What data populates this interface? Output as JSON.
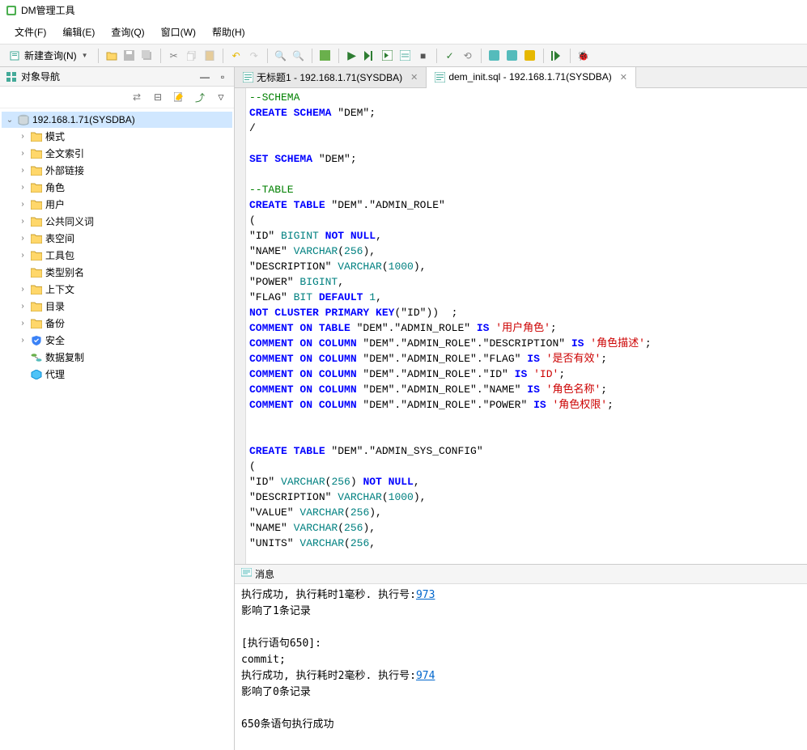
{
  "window": {
    "title": "DM管理工具"
  },
  "menu": {
    "file": "文件(F)",
    "edit": "编辑(E)",
    "query": "查询(Q)",
    "window": "窗口(W)",
    "help": "帮助(H)"
  },
  "toolbar": {
    "new_query": "新建查询(N)"
  },
  "sidebar": {
    "title": "对象导航",
    "connection": "192.168.1.71(SYSDBA)",
    "nodes": [
      {
        "label": "模式",
        "icon": "folder",
        "expandable": true
      },
      {
        "label": "全文索引",
        "icon": "folder",
        "expandable": true
      },
      {
        "label": "外部链接",
        "icon": "folder",
        "expandable": true
      },
      {
        "label": "角色",
        "icon": "folder",
        "expandable": true
      },
      {
        "label": "用户",
        "icon": "folder",
        "expandable": true
      },
      {
        "label": "公共同义词",
        "icon": "folder",
        "expandable": true
      },
      {
        "label": "表空间",
        "icon": "folder",
        "expandable": true
      },
      {
        "label": "工具包",
        "icon": "folder",
        "expandable": true
      },
      {
        "label": "类型别名",
        "icon": "folder",
        "expandable": false
      },
      {
        "label": "上下文",
        "icon": "folder",
        "expandable": true
      },
      {
        "label": "目录",
        "icon": "folder",
        "expandable": true
      },
      {
        "label": "备份",
        "icon": "folder",
        "expandable": true
      },
      {
        "label": "安全",
        "icon": "shield",
        "expandable": true
      },
      {
        "label": "数据复制",
        "icon": "replication",
        "expandable": false
      },
      {
        "label": "代理",
        "icon": "agent",
        "expandable": false
      }
    ]
  },
  "tabs": [
    {
      "label": "无标题1 - 192.168.1.71(SYSDBA)",
      "active": false
    },
    {
      "label": "dem_init.sql - 192.168.1.71(SYSDBA)",
      "active": true
    }
  ],
  "sql": {
    "lines": [
      [
        {
          "t": "cm",
          "v": "--SCHEMA"
        }
      ],
      [
        {
          "t": "kw",
          "v": "CREATE SCHEMA"
        },
        {
          "t": "",
          "v": " \"DEM\";"
        }
      ],
      [
        {
          "t": "",
          "v": "/"
        }
      ],
      [],
      [
        {
          "t": "kw",
          "v": "SET SCHEMA"
        },
        {
          "t": "",
          "v": " \"DEM\";"
        }
      ],
      [],
      [
        {
          "t": "cm",
          "v": "--TABLE"
        }
      ],
      [
        {
          "t": "kw",
          "v": "CREATE TABLE"
        },
        {
          "t": "",
          "v": " \"DEM\".\"ADMIN_ROLE\""
        }
      ],
      [
        {
          "t": "",
          "v": "("
        }
      ],
      [
        {
          "t": "",
          "v": "\"ID\" "
        },
        {
          "t": "ty",
          "v": "BIGINT"
        },
        {
          "t": "",
          "v": " "
        },
        {
          "t": "kw",
          "v": "NOT NULL"
        },
        {
          "t": "",
          "v": ","
        }
      ],
      [
        {
          "t": "",
          "v": "\"NAME\" "
        },
        {
          "t": "ty",
          "v": "VARCHAR"
        },
        {
          "t": "",
          "v": "("
        },
        {
          "t": "num",
          "v": "256"
        },
        {
          "t": "",
          "v": "),"
        }
      ],
      [
        {
          "t": "",
          "v": "\"DESCRIPTION\" "
        },
        {
          "t": "ty",
          "v": "VARCHAR"
        },
        {
          "t": "",
          "v": "("
        },
        {
          "t": "num",
          "v": "1000"
        },
        {
          "t": "",
          "v": "),"
        }
      ],
      [
        {
          "t": "",
          "v": "\"POWER\" "
        },
        {
          "t": "ty",
          "v": "BIGINT"
        },
        {
          "t": "",
          "v": ","
        }
      ],
      [
        {
          "t": "",
          "v": "\"FLAG\" "
        },
        {
          "t": "ty",
          "v": "BIT"
        },
        {
          "t": "",
          "v": " "
        },
        {
          "t": "kw",
          "v": "DEFAULT"
        },
        {
          "t": "",
          "v": " "
        },
        {
          "t": "num",
          "v": "1"
        },
        {
          "t": "",
          "v": ","
        }
      ],
      [
        {
          "t": "kw",
          "v": "NOT CLUSTER PRIMARY KEY"
        },
        {
          "t": "",
          "v": "(\"ID\"))  ;"
        }
      ],
      [
        {
          "t": "kw",
          "v": "COMMENT ON TABLE"
        },
        {
          "t": "",
          "v": " \"DEM\".\"ADMIN_ROLE\" "
        },
        {
          "t": "kw",
          "v": "IS"
        },
        {
          "t": "",
          "v": " "
        },
        {
          "t": "str",
          "v": "'用户角色'"
        },
        {
          "t": "",
          "v": ";"
        }
      ],
      [
        {
          "t": "kw",
          "v": "COMMENT ON COLUMN"
        },
        {
          "t": "",
          "v": " \"DEM\".\"ADMIN_ROLE\".\"DESCRIPTION\" "
        },
        {
          "t": "kw",
          "v": "IS"
        },
        {
          "t": "",
          "v": " "
        },
        {
          "t": "str",
          "v": "'角色描述'"
        },
        {
          "t": "",
          "v": ";"
        }
      ],
      [
        {
          "t": "kw",
          "v": "COMMENT ON COLUMN"
        },
        {
          "t": "",
          "v": " \"DEM\".\"ADMIN_ROLE\".\"FLAG\" "
        },
        {
          "t": "kw",
          "v": "IS"
        },
        {
          "t": "",
          "v": " "
        },
        {
          "t": "str",
          "v": "'是否有效'"
        },
        {
          "t": "",
          "v": ";"
        }
      ],
      [
        {
          "t": "kw",
          "v": "COMMENT ON COLUMN"
        },
        {
          "t": "",
          "v": " \"DEM\".\"ADMIN_ROLE\".\"ID\" "
        },
        {
          "t": "kw",
          "v": "IS"
        },
        {
          "t": "",
          "v": " "
        },
        {
          "t": "str",
          "v": "'ID'"
        },
        {
          "t": "",
          "v": ";"
        }
      ],
      [
        {
          "t": "kw",
          "v": "COMMENT ON COLUMN"
        },
        {
          "t": "",
          "v": " \"DEM\".\"ADMIN_ROLE\".\"NAME\" "
        },
        {
          "t": "kw",
          "v": "IS"
        },
        {
          "t": "",
          "v": " "
        },
        {
          "t": "str",
          "v": "'角色名称'"
        },
        {
          "t": "",
          "v": ";"
        }
      ],
      [
        {
          "t": "kw",
          "v": "COMMENT ON COLUMN"
        },
        {
          "t": "",
          "v": " \"DEM\".\"ADMIN_ROLE\".\"POWER\" "
        },
        {
          "t": "kw",
          "v": "IS"
        },
        {
          "t": "",
          "v": " "
        },
        {
          "t": "str",
          "v": "'角色权限'"
        },
        {
          "t": "",
          "v": ";"
        }
      ],
      [],
      [],
      [
        {
          "t": "kw",
          "v": "CREATE TABLE"
        },
        {
          "t": "",
          "v": " \"DEM\".\"ADMIN_SYS_CONFIG\""
        }
      ],
      [
        {
          "t": "",
          "v": "("
        }
      ],
      [
        {
          "t": "",
          "v": "\"ID\" "
        },
        {
          "t": "ty",
          "v": "VARCHAR"
        },
        {
          "t": "",
          "v": "("
        },
        {
          "t": "num",
          "v": "256"
        },
        {
          "t": "",
          "v": ") "
        },
        {
          "t": "kw",
          "v": "NOT NULL"
        },
        {
          "t": "",
          "v": ","
        }
      ],
      [
        {
          "t": "",
          "v": "\"DESCRIPTION\" "
        },
        {
          "t": "ty",
          "v": "VARCHAR"
        },
        {
          "t": "",
          "v": "("
        },
        {
          "t": "num",
          "v": "1000"
        },
        {
          "t": "",
          "v": "),"
        }
      ],
      [
        {
          "t": "",
          "v": "\"VALUE\" "
        },
        {
          "t": "ty",
          "v": "VARCHAR"
        },
        {
          "t": "",
          "v": "("
        },
        {
          "t": "num",
          "v": "256"
        },
        {
          "t": "",
          "v": "),"
        }
      ],
      [
        {
          "t": "",
          "v": "\"NAME\" "
        },
        {
          "t": "ty",
          "v": "VARCHAR"
        },
        {
          "t": "",
          "v": "("
        },
        {
          "t": "num",
          "v": "256"
        },
        {
          "t": "",
          "v": "),"
        }
      ],
      [
        {
          "t": "",
          "v": "\"UNITS\" "
        },
        {
          "t": "ty",
          "v": "VARCHAR"
        },
        {
          "t": "",
          "v": "("
        },
        {
          "t": "num",
          "v": "256"
        },
        {
          "t": "",
          "v": ","
        }
      ]
    ]
  },
  "messages": {
    "title": "消息",
    "line1_a": "执行成功, 执行耗时1毫秒. 执行号:",
    "exec_no_1": "973",
    "line2": "影响了1条记录",
    "line3": "[执行语句650]:",
    "line4": "commit;",
    "line5_a": "执行成功, 执行耗时2毫秒. 执行号:",
    "exec_no_2": "974",
    "line6": "影响了0条记录",
    "line7": "650条语句执行成功"
  }
}
